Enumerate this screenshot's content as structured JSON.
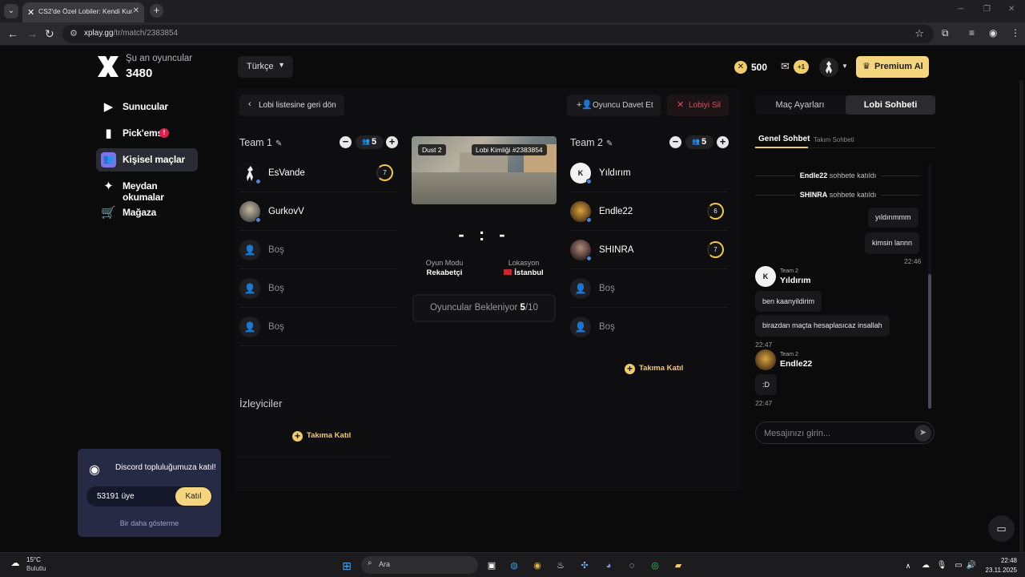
{
  "browser": {
    "tab_title": "CS2'de Özel Lobiler: Kendi Kura...",
    "url_host": "xplay.gg",
    "url_path": "/tr/match/2383854"
  },
  "sidebar": {
    "online_label": "Şu an oyuncular",
    "online_count": "3480",
    "items": [
      {
        "label": "Sunucular",
        "icon": "play-icon"
      },
      {
        "label": "Pick'ems",
        "icon": "pickems-icon",
        "badge": "!"
      },
      {
        "label": "Kişisel maçlar",
        "icon": "users-icon",
        "active": true
      },
      {
        "label": "Meydan okumalar",
        "icon": "challenge-icon"
      },
      {
        "label": "Mağaza",
        "icon": "cart-icon"
      }
    ]
  },
  "discord": {
    "title": "Discord topluluğumuza katıl!",
    "members": "53191 üye",
    "join": "Katıl",
    "dismiss": "Bir daha gösterme"
  },
  "header": {
    "language": "Türkçe",
    "coins": "500",
    "mail_badge": "+1",
    "premium": "Premium Al"
  },
  "lobby": {
    "back": "Lobi listesine geri dön",
    "invite": "Oyuncu Davet Et",
    "delete": "Lobiyi Sil",
    "team1": {
      "name": "Team 1",
      "count": "5",
      "players": [
        {
          "name": "EsVande",
          "level": "7"
        },
        {
          "name": "GurkovV",
          "level": ""
        },
        {
          "name": "Boş",
          "empty": true
        },
        {
          "name": "Boş",
          "empty": true
        },
        {
          "name": "Boş",
          "empty": true
        }
      ]
    },
    "team2": {
      "name": "Team 2",
      "count": "5",
      "players": [
        {
          "name": "Yıldırım",
          "level": ""
        },
        {
          "name": "Endle22",
          "level": "6"
        },
        {
          "name": "SHINRA",
          "level": "7"
        },
        {
          "name": "Boş",
          "empty": true
        },
        {
          "name": "Boş",
          "empty": true
        }
      ],
      "join": "Takıma Katıl"
    },
    "map": "Dust 2",
    "lobby_id": "Lobi Kimliği #2383854",
    "score": "- : -",
    "mode_label": "Oyun Modu",
    "mode_value": "Rekabetçi",
    "location_label": "Lokasyon",
    "location_value": "İstanbul",
    "waiting_text": "Oyuncular Bekleniyor",
    "waiting_current": "5",
    "waiting_total": "/10",
    "spectators": "İzleyiciler",
    "spectators_join": "Takıma Katıl"
  },
  "chat": {
    "tabs": [
      "Maç Ayarları",
      "Lobi Sohbeti"
    ],
    "subtabs": [
      "Genel Sohbet",
      "Takım Sohbeti"
    ],
    "system": [
      {
        "user": "Endle22",
        "text": "sohbete katıldı"
      },
      {
        "user": "SHINRA",
        "text": "sohbete katıldı"
      }
    ],
    "own_messages": [
      "yıldırımmm",
      "kimsin lannn"
    ],
    "own_time": "22:46",
    "groups": [
      {
        "team": "Team 2",
        "name": "Yıldırım",
        "messages": [
          "ben kaanyildirim",
          "birazdan maçta hesaplasıcaz insallah"
        ],
        "time": "22:47"
      },
      {
        "team": "Team 2",
        "name": "Endle22",
        "messages": [
          ":D"
        ],
        "time": "22:47"
      }
    ],
    "placeholder": "Mesajınızı girin..."
  },
  "taskbar": {
    "temp": "15°C",
    "weather": "Bulutlu",
    "search": "Ara",
    "time": "22:48",
    "date": "23.11.2025"
  },
  "colors": {
    "accent": "#f0cd6a",
    "active_nav": "#7e74e6",
    "danger": "#e04a5f",
    "online_dot": "#4b84d8"
  }
}
